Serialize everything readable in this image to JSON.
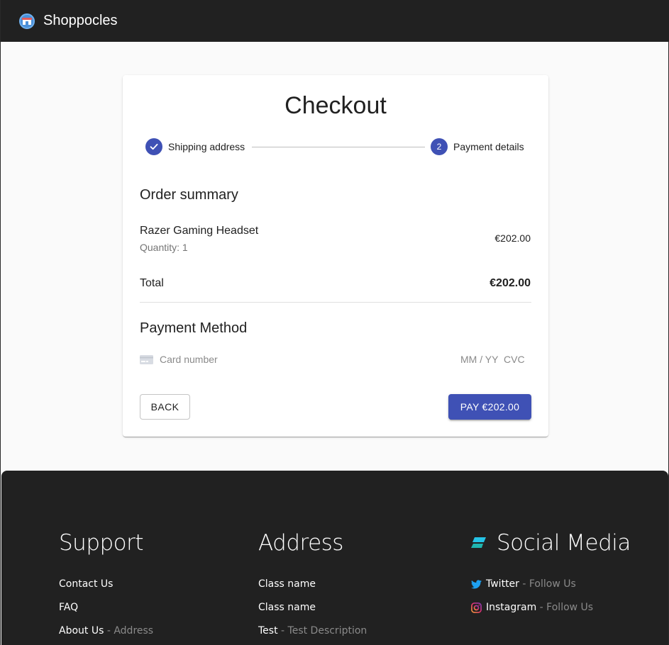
{
  "app": {
    "title": "Shoppocles",
    "logo_icon": "shop-icon"
  },
  "checkout": {
    "title": "Checkout",
    "steps": [
      {
        "label": "Shipping address",
        "state": "completed",
        "icon": "check-icon"
      },
      {
        "label": "Payment details",
        "state": "active",
        "number": "2"
      }
    ],
    "order_summary": {
      "heading": "Order summary",
      "items": [
        {
          "name": "Razer Gaming Headset",
          "quantity_text": "Quantity: 1",
          "price": "€202.00"
        }
      ],
      "total_label": "Total",
      "total_value": "€202.00"
    },
    "payment": {
      "heading": "Payment Method",
      "card_number_placeholder": "Card number",
      "expiry_placeholder": "MM / YY",
      "cvc_placeholder": "CVC"
    },
    "buttons": {
      "back": "BACK",
      "pay": "PAY €202.00"
    },
    "colors": {
      "primary": "#3f51b5",
      "appbar": "#212121"
    }
  },
  "footer": {
    "support": {
      "heading": "Support",
      "links": [
        {
          "text": "Contact Us",
          "suffix": ""
        },
        {
          "text": "FAQ",
          "suffix": ""
        },
        {
          "text": "About Us",
          "suffix": " - Address"
        }
      ]
    },
    "address": {
      "heading": "Address",
      "links": [
        {
          "text": "Class name",
          "suffix": ""
        },
        {
          "text": "Class name",
          "suffix": ""
        },
        {
          "text": "Test",
          "suffix": " - Test Description"
        }
      ]
    },
    "social": {
      "heading": "Social Media",
      "links": [
        {
          "text": "Twitter",
          "suffix": " - Follow Us",
          "icon": "twitter-icon"
        },
        {
          "text": "Instagram",
          "suffix": " - Follow Us",
          "icon": "instagram-icon"
        }
      ]
    }
  }
}
